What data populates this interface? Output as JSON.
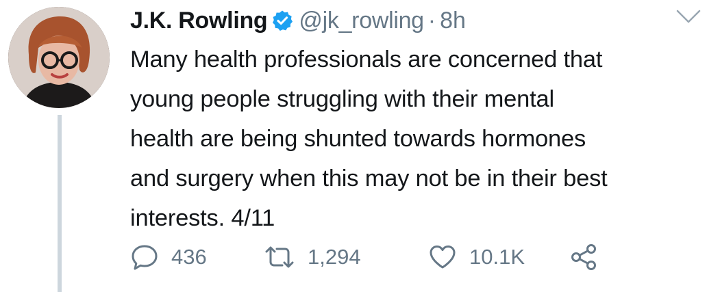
{
  "tweet": {
    "author_name": "J.K. Rowling",
    "handle": "@jk_rowling",
    "separator": "·",
    "timestamp": "8h",
    "verified": true,
    "text_lines": [
      "Many health professionals are concerned that",
      "young people struggling with their mental",
      "health are being shunted towards hormones",
      "and surgery when this may not be in their best",
      "interests. 4/11"
    ],
    "replies": "436",
    "retweets": "1,294",
    "likes": "10.1K"
  },
  "icons": {
    "verified": "verified-badge-icon",
    "menu": "chevron-down-icon",
    "reply": "reply-icon",
    "retweet": "retweet-icon",
    "like": "heart-icon",
    "share": "share-icon"
  },
  "colors": {
    "text": "#14171a",
    "secondary": "#657786",
    "verified": "#1da1f2",
    "thread_line": "#cdd6dd"
  }
}
